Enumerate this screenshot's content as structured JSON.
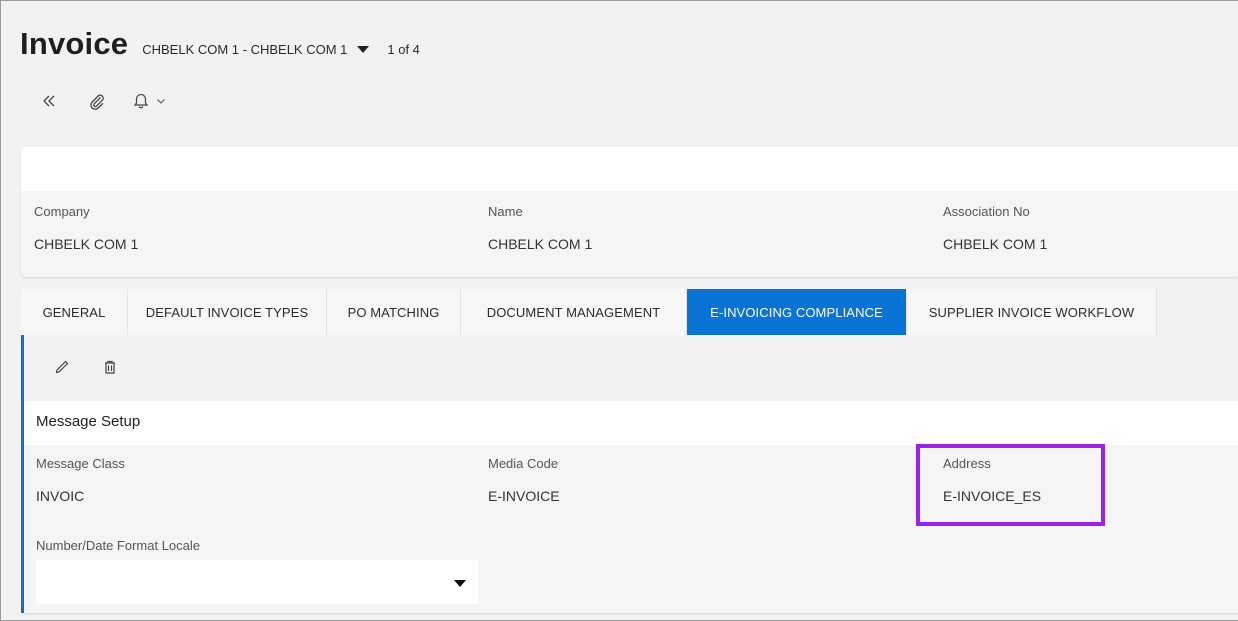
{
  "header": {
    "title": "Invoice",
    "record_selector": "CHBELK COM 1 - CHBELK COM 1",
    "record_count": "1 of 4"
  },
  "toolbar": {
    "icons": [
      "double-chevron-left-icon",
      "paperclip-icon",
      "bell-icon",
      "chevron-down-icon"
    ]
  },
  "company_header": {
    "fields": [
      {
        "label": "Company",
        "value": "CHBELK COM 1"
      },
      {
        "label": "Name",
        "value": "CHBELK COM 1"
      },
      {
        "label": "Association No",
        "value": "CHBELK COM 1"
      }
    ]
  },
  "tabs": [
    {
      "label": "GENERAL",
      "active": false
    },
    {
      "label": "DEFAULT INVOICE TYPES",
      "active": false
    },
    {
      "label": "PO MATCHING",
      "active": false
    },
    {
      "label": "DOCUMENT MANAGEMENT",
      "active": false
    },
    {
      "label": "E-INVOICING COMPLIANCE",
      "active": true
    },
    {
      "label": "SUPPLIER INVOICE WORKFLOW",
      "active": false
    }
  ],
  "message_setup": {
    "title": "Message Setup",
    "fields": [
      {
        "label": "Message Class",
        "value": "INVOIC"
      },
      {
        "label": "Media Code",
        "value": "E-INVOICE"
      },
      {
        "label": "Address",
        "value": "E-INVOICE_ES"
      }
    ],
    "locale": {
      "label": "Number/Date Format Locale",
      "value": ""
    }
  },
  "colors": {
    "accent": "#0a74d6",
    "highlight": "#9b22e8",
    "background": "#f3f2f2"
  }
}
